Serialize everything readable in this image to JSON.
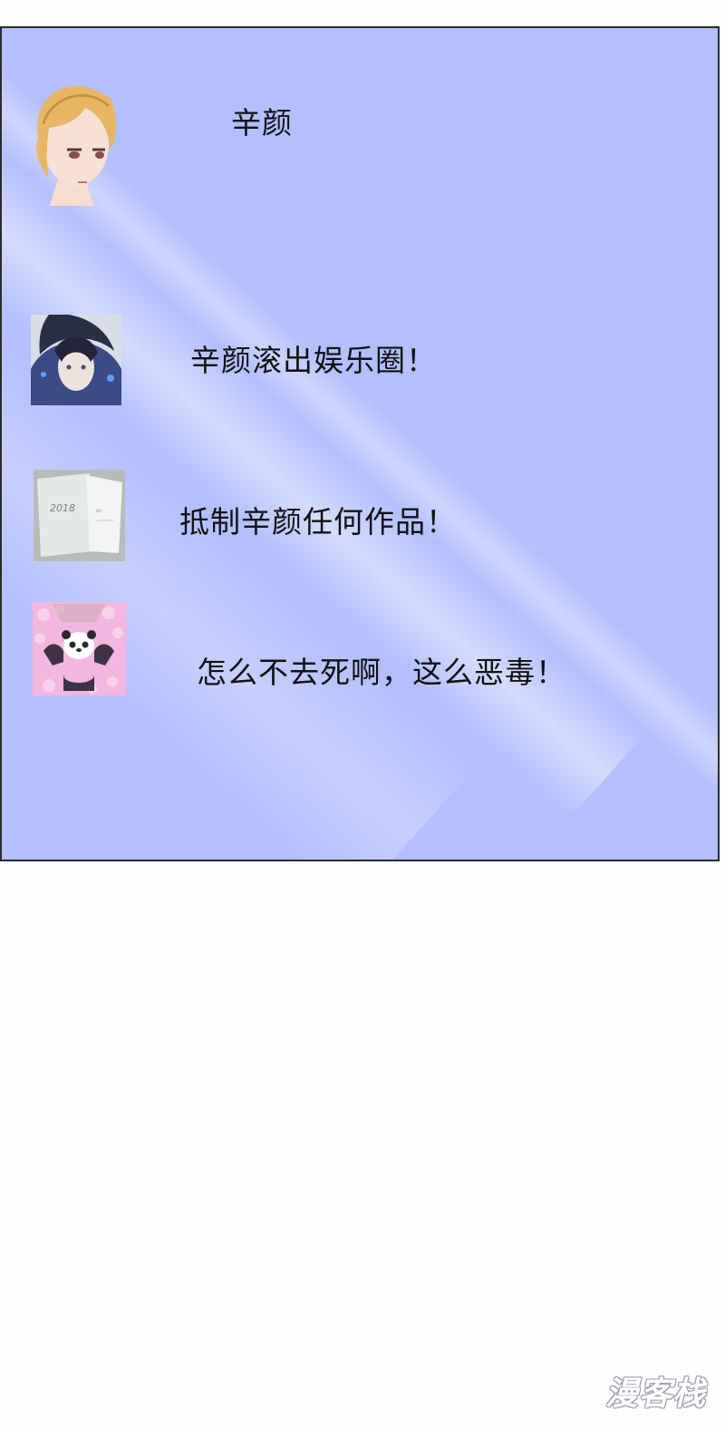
{
  "poster": {
    "name": "辛颜",
    "avatar_icon": "blonde-character-avatar-icon"
  },
  "comments": [
    {
      "text": "辛颜滚出娱乐圈！",
      "avatar_icon": "dark-hair-character-avatar-icon"
    },
    {
      "text": "抵制辛颜任何作品！",
      "avatar_icon": "notebook-photo-avatar-icon"
    },
    {
      "text": "怎么不去死啊，这么恶毒！",
      "avatar_icon": "panda-avatar-icon"
    }
  ],
  "watermark": "漫客栈",
  "colors": {
    "panel_background": "#b3bffe",
    "page_background": "#fefefe",
    "text": "#111111"
  }
}
